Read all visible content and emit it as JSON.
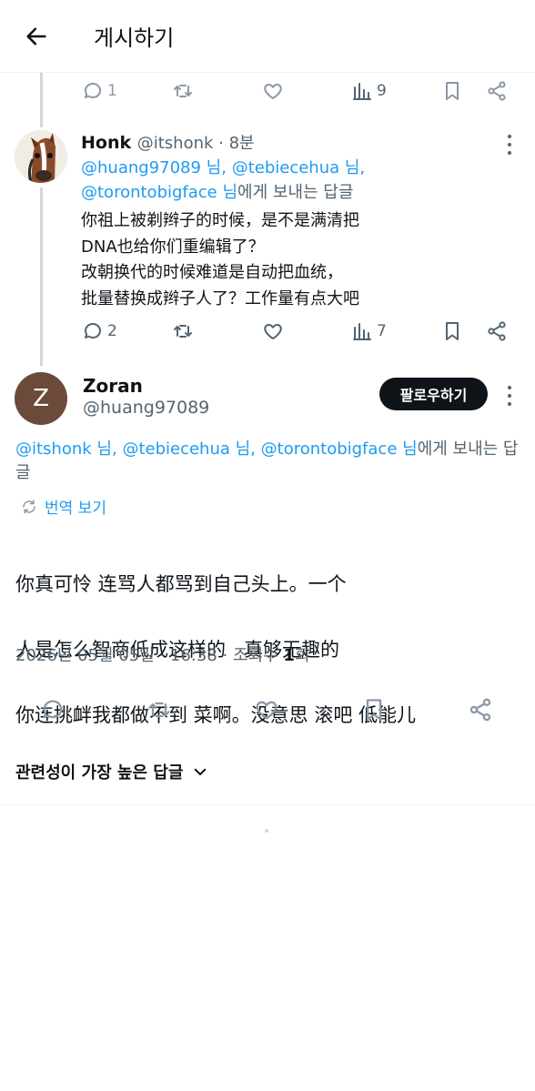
{
  "header": {
    "title": "게시하기"
  },
  "prev_tweet_actions": {
    "replies": "1",
    "views": "9"
  },
  "honk_tweet": {
    "name": "Honk",
    "meta": "@itshonk · 8분",
    "reply_to": {
      "mention1": "@huang97089 님,",
      "mention2": "@tebiecehua 님,",
      "mention3": "@torontobigface 님",
      "suffix": "에게 보내는 답글"
    },
    "text_lines": [
      "你祖上被剃辫子的时候，是不是满清把",
      "DNA也给你们重编辑了？",
      "改朝换代的时候难道是自动把血统，",
      "批量替换成辫子人了？工作量有点大吧"
    ],
    "actions": {
      "replies": "2",
      "views": "7"
    }
  },
  "main_tweet": {
    "avatar_letter": "Z",
    "name": "Zoran",
    "handle": "@huang97089",
    "follow_label": "팔로우하기",
    "reply_to": {
      "mention1": "@itshonk 님,",
      "mention2": "@tebiecehua 님,",
      "mention3": "@torontobigface 님",
      "suffix": "에게 보내는 답글"
    },
    "translate_label": "번역 보기",
    "text_lines": [
      "你真可怜 连骂人都骂到自己头上。一个",
      "人是怎么智商低成这样的   真够无趣的",
      "你连挑衅我都做不到 菜啊。没意思 滚吧 低能儿"
    ],
    "timestamp": "2026년 05월 05일 · 16:38 · 조회수 ",
    "view_count": "1",
    "view_suffix": "회"
  },
  "sort_label": "관련성이 가장 높은 답글",
  "colors": {
    "accent": "#1d9bf0",
    "text": "#0f1419",
    "muted": "#536471",
    "follow_bg": "#0f1419"
  }
}
